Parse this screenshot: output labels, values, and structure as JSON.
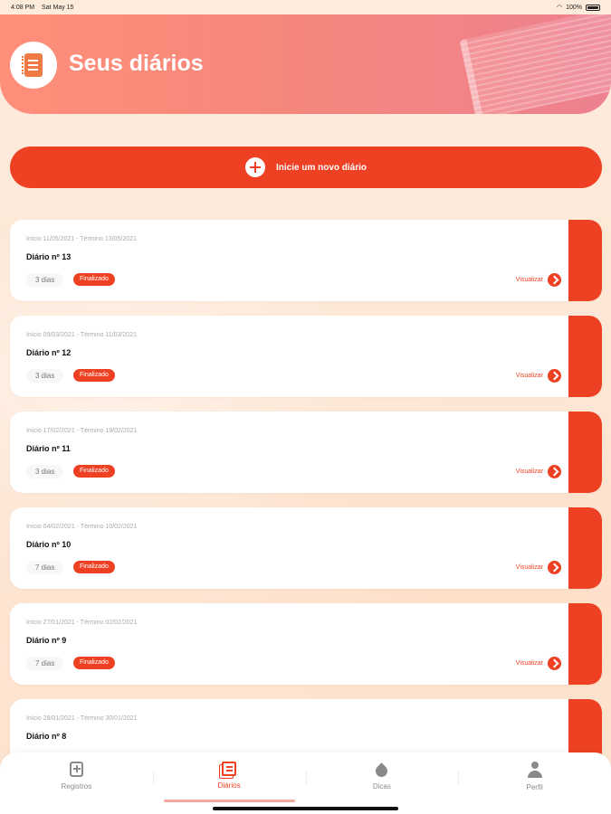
{
  "status_bar": {
    "time": "4:08 PM",
    "date": "Sat May 15",
    "battery": "100%"
  },
  "header": {
    "title": "Seus diários"
  },
  "new_diary": {
    "label": "Inicie um novo diário"
  },
  "diaries": [
    {
      "dates": "Início 11/05/2021 - Término 13/05/2021",
      "title": "Diário nº 13",
      "days": "3 dias",
      "status": "Finalizado",
      "action": "Visualizar"
    },
    {
      "dates": "Início 09/03/2021 - Término 11/03/2021",
      "title": "Diário nº 12",
      "days": "3 dias",
      "status": "Finalizado",
      "action": "Visualizar"
    },
    {
      "dates": "Início 17/02/2021 - Término 19/02/2021",
      "title": "Diário nº 11",
      "days": "3 dias",
      "status": "Finalizado",
      "action": "Visualizar"
    },
    {
      "dates": "Início 04/02/2021 - Término 10/02/2021",
      "title": "Diário nº 10",
      "days": "7 dias",
      "status": "Finalizado",
      "action": "Visualizar"
    },
    {
      "dates": "Início 27/01/2021 - Término 02/02/2021",
      "title": "Diário nº 9",
      "days": "7 dias",
      "status": "Finalizado",
      "action": "Visualizar"
    },
    {
      "dates": "Início 28/01/2021 - Término 30/01/2021",
      "title": "Diário nº 8",
      "days": "",
      "status": "",
      "action": ""
    }
  ],
  "tabbar": {
    "items": [
      {
        "label": "Registros",
        "icon": "add-record-icon",
        "active": false
      },
      {
        "label": "Diários",
        "icon": "diaries-icon",
        "active": true
      },
      {
        "label": "Dicas",
        "icon": "drop-icon",
        "active": false
      },
      {
        "label": "Perfil",
        "icon": "user-icon",
        "active": false
      }
    ]
  },
  "colors": {
    "accent": "#ee4123",
    "header_from": "#ff8f7a",
    "header_to": "#ee8090",
    "background": "#fde9da"
  }
}
